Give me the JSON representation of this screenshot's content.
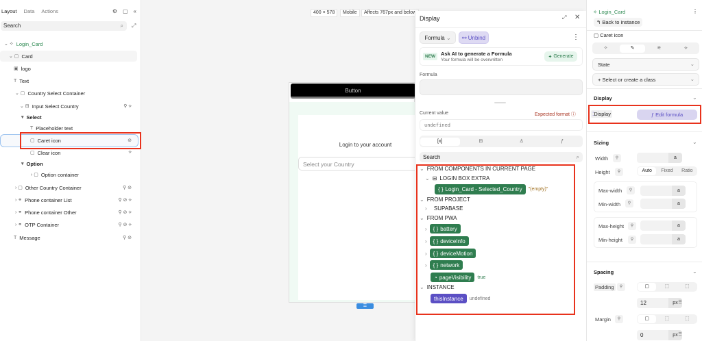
{
  "left_panel": {
    "tabs": [
      "Layout",
      "Data",
      "Actions"
    ],
    "search_placeholder": "Search",
    "tree": [
      {
        "label": "Login_Card",
        "icon": "component-icon",
        "badges": ""
      },
      {
        "label": "Card",
        "icon": "box-icon",
        "badges": ""
      },
      {
        "label": "logo",
        "icon": "image-icon",
        "badges": ""
      },
      {
        "label": "Text",
        "icon": "text-icon",
        "badges": ""
      },
      {
        "label": "Country Select Container",
        "icon": "box-icon",
        "badges": ""
      },
      {
        "label": "Input Select Country",
        "icon": "select-icon",
        "badges": "⚲ ⟡"
      },
      {
        "label": "Select",
        "icon": "",
        "badges": ""
      },
      {
        "label": "Placeholder text",
        "icon": "text-icon",
        "badges": ""
      },
      {
        "label": "Caret icon",
        "icon": "box-icon",
        "badges": "⊘"
      },
      {
        "label": "Clear icon",
        "icon": "box-icon",
        "badges": "⟡"
      },
      {
        "label": "Option",
        "icon": "",
        "badges": ""
      },
      {
        "label": "Option container",
        "icon": "box-icon",
        "badges": ""
      },
      {
        "label": "Other Country Container",
        "icon": "box-icon",
        "badges": "⚲ ⊘"
      },
      {
        "label": "Phone container List",
        "icon": "link-icon",
        "badges": "⚲ ⊘ ⟡"
      },
      {
        "label": "Phone container Other",
        "icon": "link-icon",
        "badges": "⚲ ⊘ ⟡"
      },
      {
        "label": "OTP Container",
        "icon": "link-icon",
        "badges": "⚲ ⊘ ⟡"
      },
      {
        "label": "Message",
        "icon": "text-icon",
        "badges": "⚲ ⊘"
      }
    ]
  },
  "canvas": {
    "size": "400 × 578",
    "device": "Mobile",
    "affects": "Affects 767px and below",
    "button": "Button",
    "login_text": "Login to your account",
    "country_placeholder": "Select your Country"
  },
  "popup": {
    "title": "Display",
    "mode": "Formula",
    "unbind": "Unbind",
    "new_badge": "NEW",
    "ai_title": "Ask AI to generate a Formula",
    "ai_sub": "Your formula will be overwritten",
    "generate": "Generate",
    "formula_label": "Formula",
    "current_value_label": "Current value",
    "expected_format": "Expected format",
    "current_value": "undefined",
    "search_placeholder": "Search",
    "sections": {
      "components": "FROM COMPONENTS IN CURRENT PAGE",
      "login_box": "LOGIN BOX EXTRA",
      "selected_country": "Login_Card - Selected_Country",
      "selected_country_value": "\"(empty)\"",
      "project": "FROM PROJECT",
      "supabase": "SUPABASE",
      "pwa": "FROM PWA",
      "battery": "battery",
      "deviceInfo": "deviceInfo",
      "deviceMotion": "deviceMotion",
      "network": "network",
      "pageVisibility": "pageVisibility",
      "pageVisibility_value": "true",
      "instance": "INSTANCE",
      "thisInstance": "thisInstance",
      "thisInstance_value": "undefined"
    }
  },
  "right_panel": {
    "component": "Login_Card",
    "back": "Back to instance",
    "element": "Caret icon",
    "state": "State",
    "class": "Select or create a class",
    "display_section": "Display",
    "display_label": "Display",
    "edit_formula": "Edit formula",
    "sizing": "Sizing",
    "width": "Width",
    "height": "Height",
    "height_modes": [
      "Auto",
      "Fixed",
      "Ratio"
    ],
    "max_width": "Max-width",
    "min_width": "Min-width",
    "max_height": "Max-height",
    "min_height": "Min-height",
    "auto_unit": "a",
    "spacing": "Spacing",
    "padding": "Padding",
    "padding_value": "12",
    "margin": "Margin",
    "margin_value": "0",
    "unit": "px"
  },
  "colors": {
    "accent_green": "#2f7d4f",
    "highlight_red": "#e8321c",
    "purple": "#5b4fc4"
  }
}
